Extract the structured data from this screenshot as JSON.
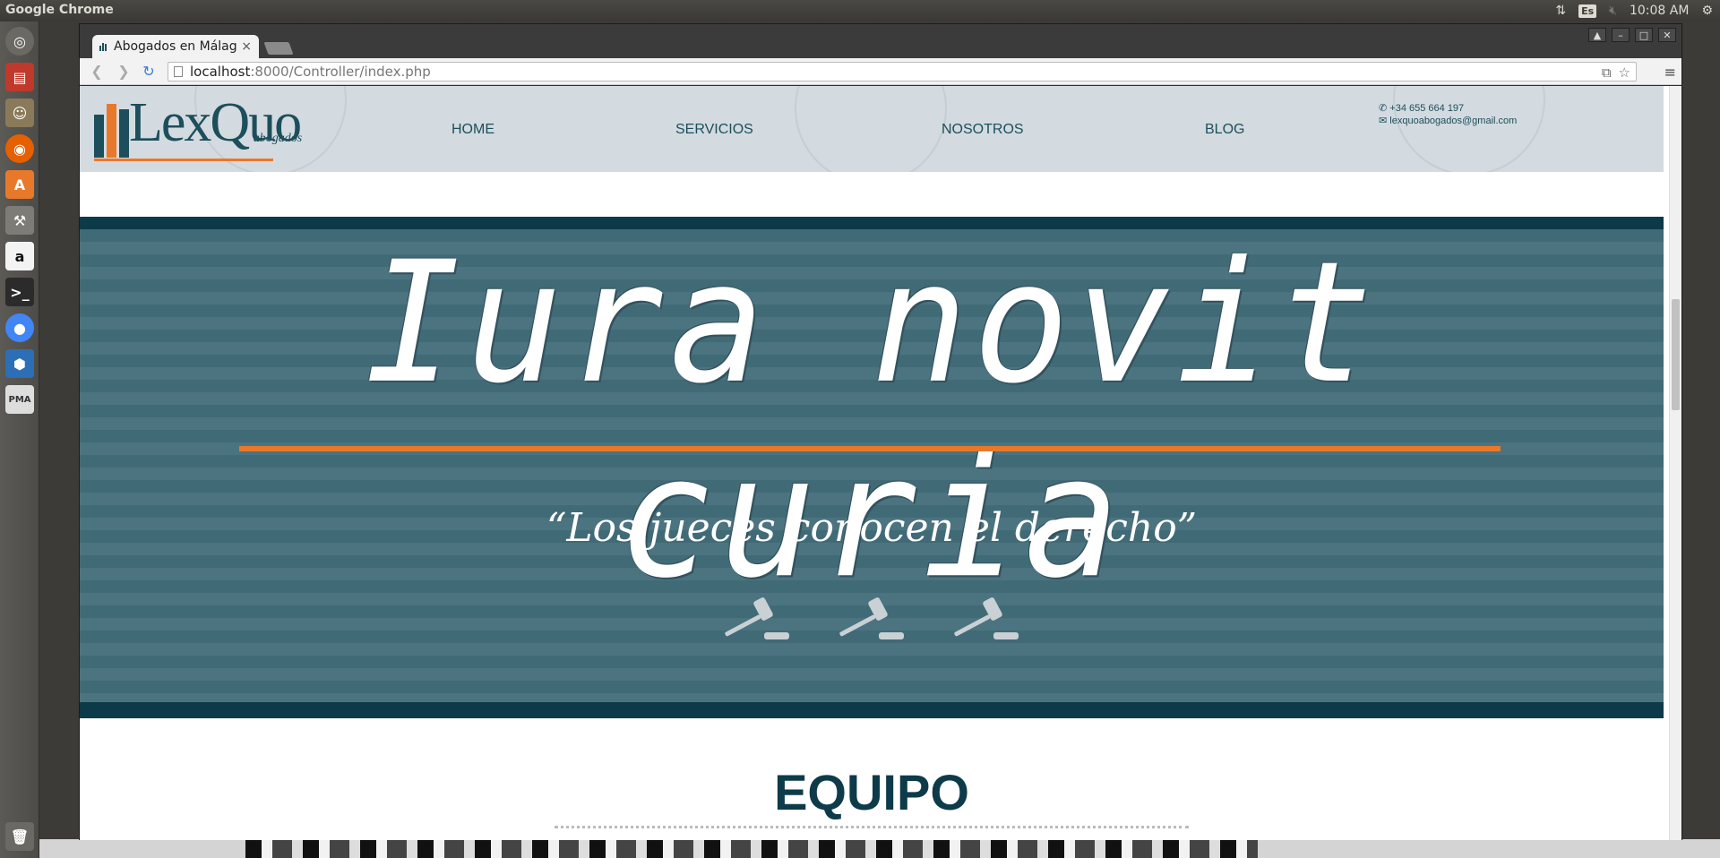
{
  "os": {
    "app_title": "Google Chrome",
    "keyboard_layout": "Es",
    "clock": "10:08 AM"
  },
  "launcher": {
    "items": [
      "ubuntu-home",
      "file-manager",
      "gimp",
      "firefox",
      "software-center",
      "system-settings",
      "amazon",
      "terminal",
      "chrome",
      "virtualbox",
      "pma",
      "trash"
    ]
  },
  "browser": {
    "tab_title": "Abogados en Málaga",
    "url_host": "localhost",
    "url_rest": ":8000/Controller/index.php",
    "window_buttons": [
      "▲",
      "–",
      "□",
      "✕"
    ]
  },
  "site": {
    "logo_name": "LexQuo",
    "logo_sub": "abogados",
    "nav": [
      "HOME",
      "SERVICIOS",
      "NOSOTROS",
      "BLOG"
    ],
    "phone": "+34 655 664 197",
    "email": "lexquoabogados@gmail.com",
    "banner": {
      "motto": "Iura novit curia",
      "translation": "“Los jueces conocen el derecho”"
    },
    "section_title": "EQUIPO"
  },
  "colors": {
    "brand_teal": "#1d4e5b",
    "brand_orange": "#e8792b",
    "banner_bg": "#416a77"
  }
}
